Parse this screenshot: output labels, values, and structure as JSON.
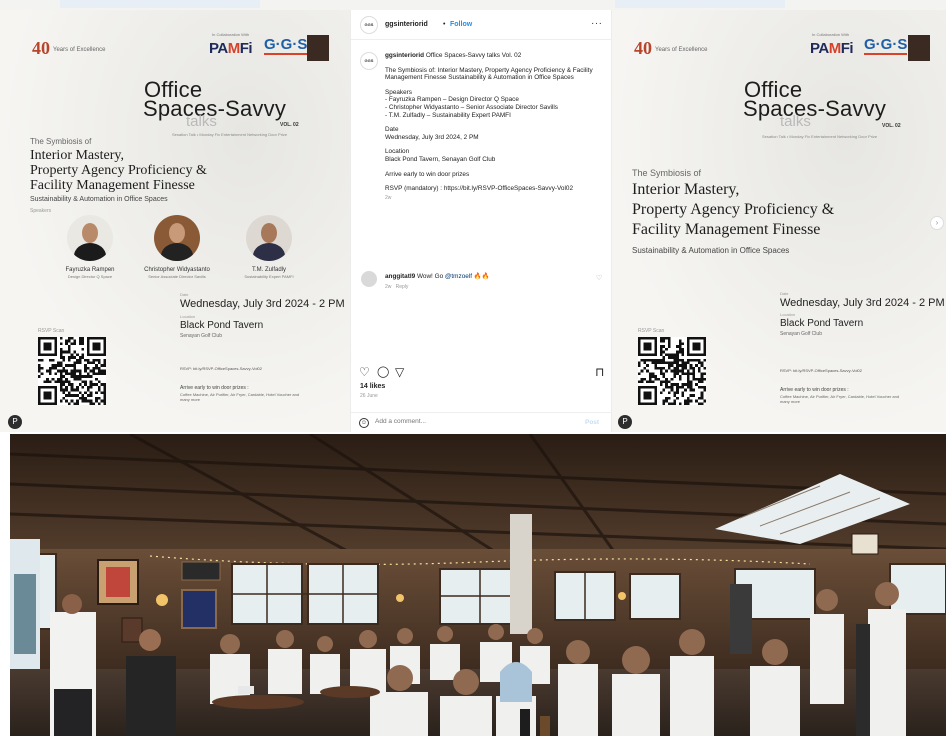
{
  "poster_left": {
    "logo_40": "40",
    "logo_40_sub": "Years of Excellence",
    "collab": "In Collaboration With",
    "pamfi_a": "PA",
    "pamfi_m": "M",
    "pamfi_b": "Fi",
    "ggs": "G·G·S",
    "title_line1": "Office",
    "title_line2": "Spaces-Savvy",
    "talks": "talks",
    "vol": "VOL. 02",
    "tagline": "Sesation Talk • Monday Fix Entertainment Networking Door Prize",
    "symbiosis": "The Symbiosis of",
    "line1": "Interior Mastery,",
    "line2": "Property Agency Proficiency &",
    "line3": "Facility Management Finesse",
    "sustain": "Sustainability & Automation in Office Spaces",
    "speakers_label": "Speakers",
    "speakers": [
      {
        "name": "Fayruzka Rampen",
        "role": "Design Director Q Space"
      },
      {
        "name": "Christopher Widyastanto",
        "role": "Senior Associate Director Savills"
      },
      {
        "name": "T.M. Zulfadly",
        "role": "Sustainability Expert PAMFI"
      }
    ],
    "date_label": "Date",
    "date": "Wednesday, July 3rd 2024 - 2 PM",
    "venue_label": "Location",
    "venue": "Black Pond Tavern",
    "venue_sub": "Senayan Golf Club",
    "rsvp_label": "RSVP Scan",
    "rsvp_url": "RSVP: bit.ly/RSVP-OfficeSpaces-Savvy-Vol02",
    "prize_head": "Arrive early to win door prizes :",
    "prize_body": "Coffee Machine, Air Purifier, Air Fryer, Cardable, Hotel Voucher and many more",
    "profile_icon": "P"
  },
  "poster_right": {
    "logo_40": "40",
    "logo_40_sub": "Years of Excellence",
    "collab": "In Collaboration With",
    "pamfi_a": "PA",
    "pamfi_m": "M",
    "pamfi_b": "Fi",
    "ggs": "G·G·S",
    "title_line1": "Office",
    "title_line2": "Spaces-Savvy",
    "talks": "talks",
    "vol": "VOL. 02",
    "tagline": "Sesation Talk • Monday Fix Entertainment Networking Door Prize",
    "symbiosis": "The Symbiosis of",
    "line1": "Interior Mastery,",
    "line2": "Property Agency Proficiency &",
    "line3": "Facility Management Finesse",
    "sustain": "Sustainability & Automation in Office Spaces",
    "date_label": "Date",
    "date": "Wednesday, July 3rd 2024 - 2 PM",
    "venue_label": "Location",
    "venue": "Black Pond Tavern",
    "venue_sub": "Senayan Golf Club",
    "rsvp_label": "RSVP Scan",
    "rsvp_url": "RSVP: bit.ly/RSVP-OfficeSpaces-Savvy-Vol02",
    "prize_head": "Arrive early to win door prizes :",
    "prize_body": "Coffee Machine, Air Purifier, Air Fryer, Cardable, Hotel Voucher and many more",
    "profile_icon": "P",
    "next_icon": "›"
  },
  "instagram": {
    "avatar_text": "GGS",
    "handle": "ggsinteriorid",
    "dot": "•",
    "follow": "Follow",
    "more": "···",
    "caption_handle": "ggsinteriorid",
    "caption_title": "Office Spaces-Savvy talks Vol. 02",
    "caption_p1": "The Symbiosis of: Interior Mastery, Property Agency Proficiency & Facility Management Finesse Sustainability & Automation in Office Spaces",
    "speakers_head": "Speakers",
    "speaker1": "- Fayruzka Rampen – Design Director Q Space",
    "speaker2": "- Christopher Widyastanto – Senior Associate Director Savills",
    "speaker3": "- T.M. Zulfadly – Sustainability Expert PAMFI",
    "date_head": "Date",
    "date": "Wednesday, July 3rd 2024, 2 PM",
    "location_head": "Location",
    "location": "Black Pond Tavern, Senayan Golf Club",
    "prizes": "Arrive early to win door prizes",
    "rsvp": "RSVP (mandatory) : https://bit.ly/RSVP-OfficeSpaces-Savvy-Vol02",
    "caption_time": "2w",
    "comment_user": "anggitatl9",
    "comment_text": "Wow! Go",
    "comment_tag": "@tmzoelf",
    "comment_emoji": "🔥🔥",
    "comment_time": "2w",
    "comment_reply": "Reply",
    "likes": "14 likes",
    "post_date": "26 June",
    "add_comment_placeholder": "Add a comment...",
    "post_label": "Post",
    "icons": {
      "heart": "♡",
      "comment": "◯",
      "share": "▽",
      "save": "⊓",
      "smiley": "☺"
    }
  },
  "colors": {
    "follow_blue": "#1d90f0",
    "pamfi_navy": "#1e2a5a",
    "accent_red": "#d6412b",
    "ggs_blue": "#1f5fa8"
  }
}
